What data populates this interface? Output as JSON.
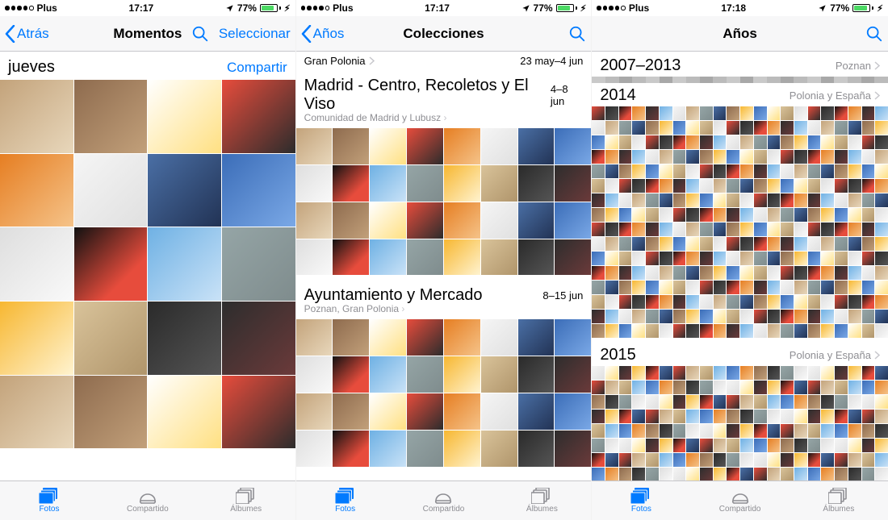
{
  "status": {
    "carrier": "Plus",
    "battery_pct": "77%"
  },
  "tabbar": {
    "photos": "Fotos",
    "shared": "Compartido",
    "albums": "Álbumes"
  },
  "screens": [
    {
      "time": "17:17",
      "nav": {
        "back": "Atrás",
        "title": "Momentos",
        "select": "Seleccionar"
      },
      "section": {
        "title": "jueves",
        "action": "Compartir"
      }
    },
    {
      "time": "17:17",
      "nav": {
        "back": "Años",
        "title": "Colecciones"
      },
      "top_crumb": {
        "label": "Gran Polonia",
        "date": "23 may–4 jun"
      },
      "coll1": {
        "title": "Madrid - Centro, Recoletos y El Viso",
        "sub": "Comunidad de Madrid y Lubusz",
        "date": "4–8 jun"
      },
      "coll2": {
        "title": "Ayuntamiento y Mercado",
        "sub": "Poznan, Gran Polonia",
        "date": "8–15 jun"
      }
    },
    {
      "time": "17:18",
      "nav": {
        "title": "Años"
      },
      "y1": {
        "title": "2007–2013",
        "loc": "Poznan"
      },
      "y2": {
        "title": "2014",
        "loc": "Polonia y España"
      },
      "y3": {
        "title": "2015",
        "loc": "Polonia y España"
      }
    }
  ]
}
